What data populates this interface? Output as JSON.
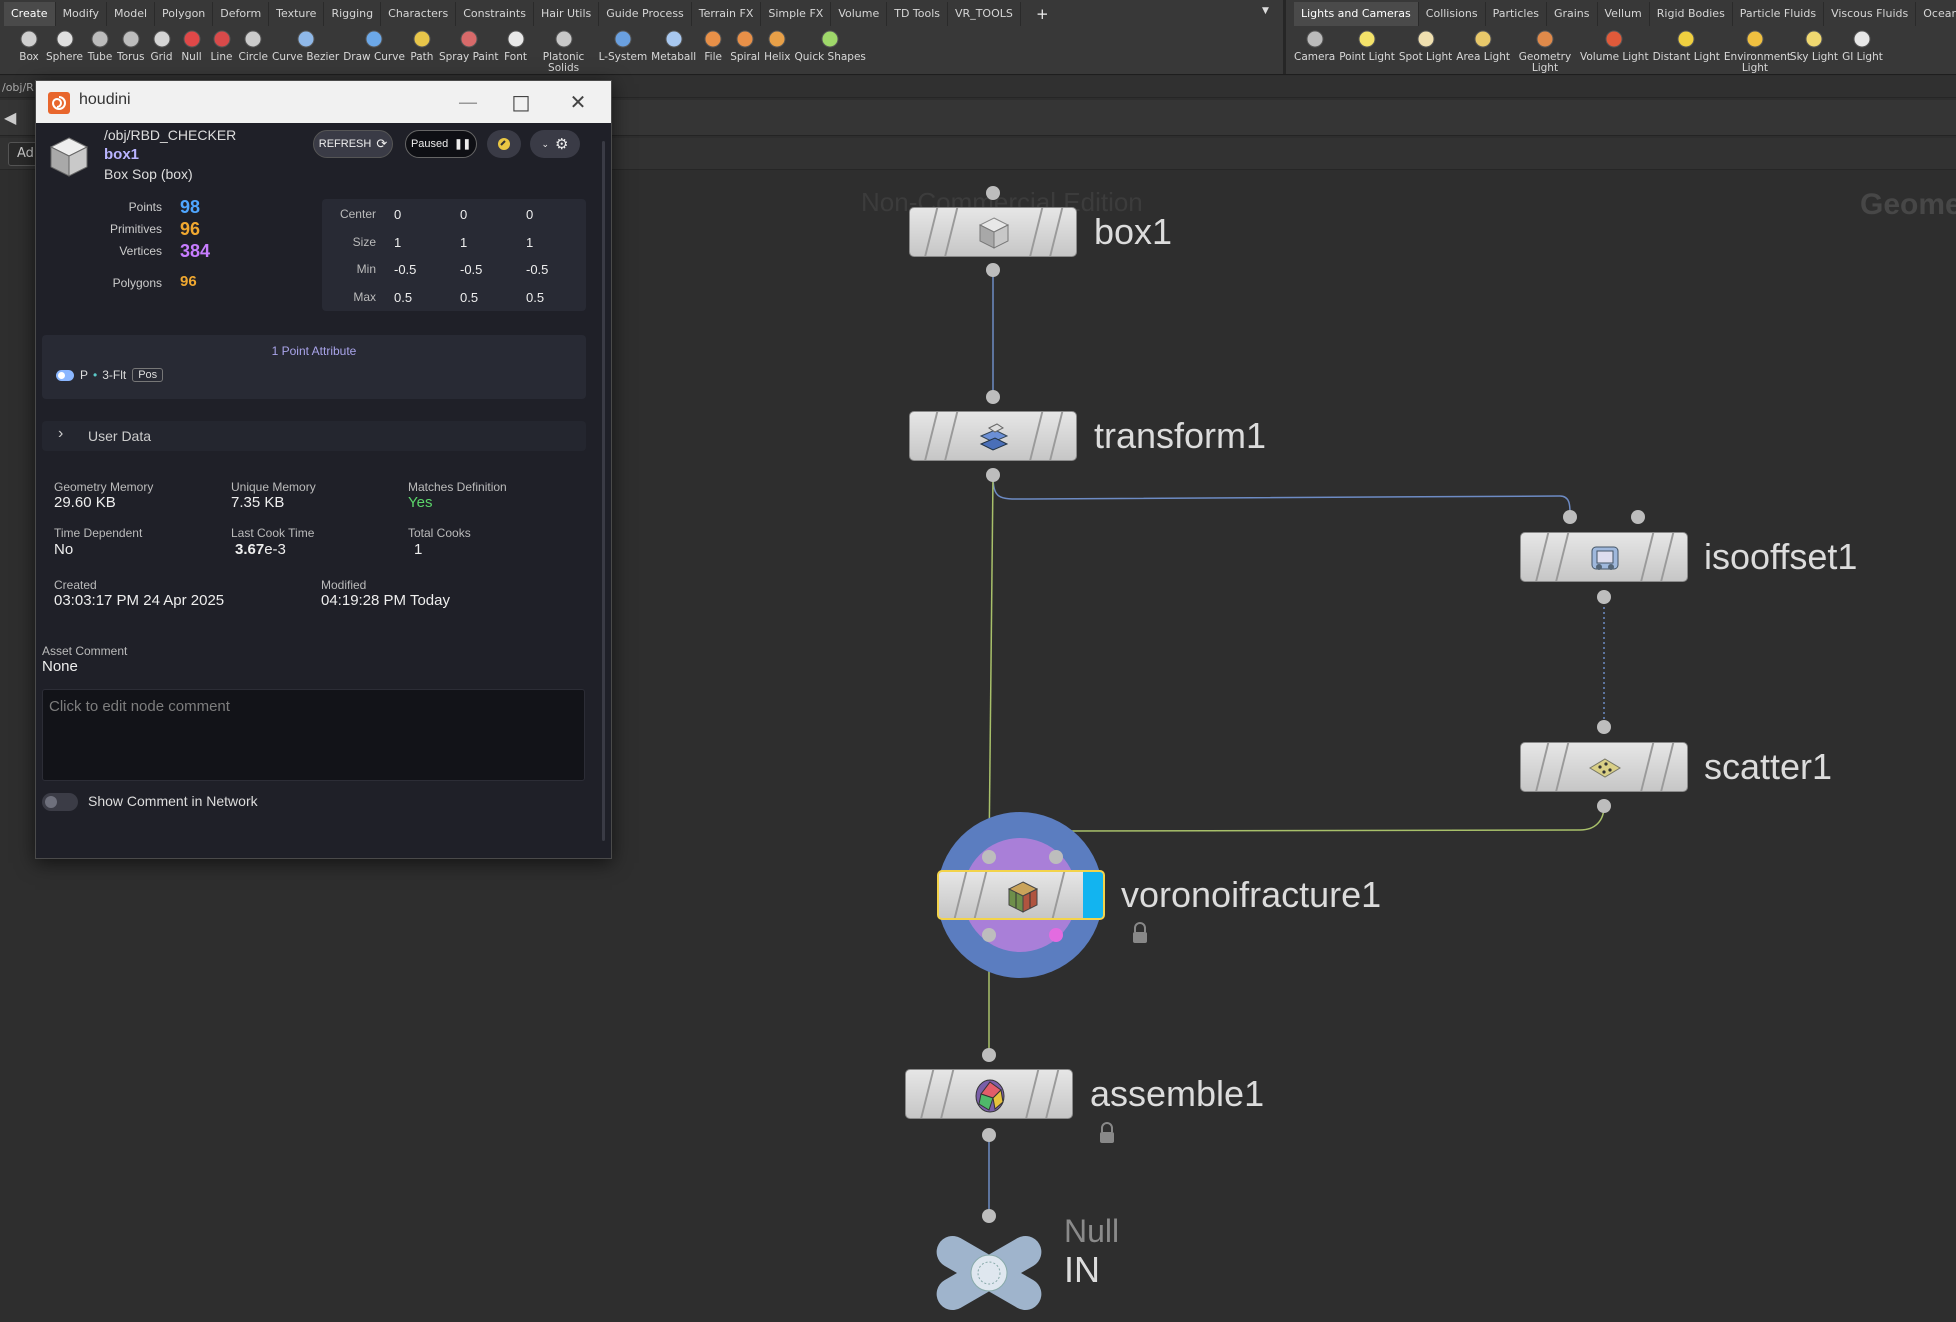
{
  "shelf": {
    "left_tabs": [
      "Create",
      "Modify",
      "Model",
      "Polygon",
      "Deform",
      "Texture",
      "Rigging",
      "Characters",
      "Constraints",
      "Hair Utils",
      "Guide Process",
      "Terrain FX",
      "Simple FX",
      "Volume",
      "TD Tools",
      "VR_TOOLS"
    ],
    "right_tabs": [
      "Lights and Cameras",
      "Collisions",
      "Particles",
      "Grains",
      "Vellum",
      "Rigid Bodies",
      "Particle Fluids",
      "Viscous Fluids",
      "Oceans"
    ],
    "add_tab": "+",
    "dropdown": "▼",
    "left_tools": [
      {
        "label": "Box",
        "icon": "box-icon"
      },
      {
        "label": "Sphere",
        "icon": "sphere-icon"
      },
      {
        "label": "Tube",
        "icon": "tube-icon"
      },
      {
        "label": "Torus",
        "icon": "torus-icon"
      },
      {
        "label": "Grid",
        "icon": "grid-icon"
      },
      {
        "label": "Null",
        "icon": "null-icon"
      },
      {
        "label": "Line",
        "icon": "line-icon"
      },
      {
        "label": "Circle",
        "icon": "circle-icon"
      },
      {
        "label": "Curve Bezier",
        "icon": "curve-bezier-icon"
      },
      {
        "label": "Draw Curve",
        "icon": "draw-curve-icon"
      },
      {
        "label": "Path",
        "icon": "path-icon"
      },
      {
        "label": "Spray Paint",
        "icon": "spray-paint-icon"
      },
      {
        "label": "Font",
        "icon": "font-icon"
      },
      {
        "label": "Platonic Solids",
        "icon": "platonic-solids-icon"
      },
      {
        "label": "L-System",
        "icon": "l-system-icon"
      },
      {
        "label": "Metaball",
        "icon": "metaball-icon"
      },
      {
        "label": "File",
        "icon": "file-icon"
      },
      {
        "label": "Spiral",
        "icon": "spiral-icon"
      },
      {
        "label": "Helix",
        "icon": "helix-icon"
      },
      {
        "label": "Quick Shapes",
        "icon": "quick-shapes-icon"
      }
    ],
    "right_tools": [
      {
        "label": "Camera",
        "icon": "camera-icon"
      },
      {
        "label": "Point Light",
        "icon": "point-light-icon"
      },
      {
        "label": "Spot Light",
        "icon": "spot-light-icon"
      },
      {
        "label": "Area Light",
        "icon": "area-light-icon"
      },
      {
        "label": "Geometry Light",
        "icon": "geometry-light-icon"
      },
      {
        "label": "Volume Light",
        "icon": "volume-light-icon"
      },
      {
        "label": "Distant Light",
        "icon": "distant-light-icon"
      },
      {
        "label": "Environment Light",
        "icon": "environment-light-icon"
      },
      {
        "label": "Sky Light",
        "icon": "sky-light-icon"
      },
      {
        "label": "GI Light",
        "icon": "gi-light-icon"
      }
    ]
  },
  "pathbar": {
    "text": "/obj/R"
  },
  "toolbar2": {
    "add_label": "Ad"
  },
  "network": {
    "watermark": "Non-Commercial Edition",
    "context_label": "Geome",
    "nodes": {
      "box1": "box1",
      "transform1": "transform1",
      "isooffset1": "isooffset1",
      "scatter1": "scatter1",
      "voronoifracture1": "voronoifracture1",
      "assemble1": "assemble1",
      "null_type": "Null",
      "null_name": "IN"
    }
  },
  "info": {
    "window_title": "houdini",
    "path": "/obj/RBD_CHECKER",
    "node_name": "box1",
    "node_type": "Box Sop (box)",
    "refresh_label": "REFRESH",
    "paused_label": "Paused",
    "stats": [
      {
        "label": "Points",
        "value": "98",
        "color": "#4fa6ff"
      },
      {
        "label": "Primitives",
        "value": "96",
        "color": "#f0a830"
      },
      {
        "label": "Vertices",
        "value": "384",
        "color": "#c77dff"
      },
      {
        "label": "Polygons",
        "value": "96",
        "color": "#f0a830"
      }
    ],
    "bbox": {
      "rows": [
        {
          "label": "Center",
          "x": "0",
          "y": "0",
          "z": "0"
        },
        {
          "label": "Size",
          "x": "1",
          "y": "1",
          "z": "1"
        },
        {
          "label": "Min",
          "x": "-0.5",
          "y": "-0.5",
          "z": "-0.5"
        },
        {
          "label": "Max",
          "x": "0.5",
          "y": "0.5",
          "z": "0.5"
        }
      ]
    },
    "attributes": {
      "header": "1 Point Attribute",
      "name": "P",
      "type": "3-Flt",
      "tag": "Pos"
    },
    "user_data_label": "User Data",
    "memory": {
      "geometry_label": "Geometry Memory",
      "geometry_value": "29.60 KB",
      "unique_label": "Unique Memory",
      "unique_value": "7.35 KB",
      "matches_label": "Matches Definition",
      "matches_value": "Yes",
      "time_dep_label": "Time Dependent",
      "time_dep_value": "No",
      "last_cook_label": "Last Cook Time",
      "last_cook_value": "3.67",
      "last_cook_exp": "e-3",
      "total_cooks_label": "Total Cooks",
      "total_cooks_value": "1"
    },
    "dates": {
      "created_label": "Created",
      "created_value": "03:03:17 PM 24 Apr 2025",
      "modified_label": "Modified",
      "modified_value": "04:19:28 PM Today"
    },
    "asset_comment_label": "Asset Comment",
    "asset_comment_value": "None",
    "comment_placeholder": "Click to edit node comment",
    "show_comment_label": "Show Comment in Network"
  }
}
